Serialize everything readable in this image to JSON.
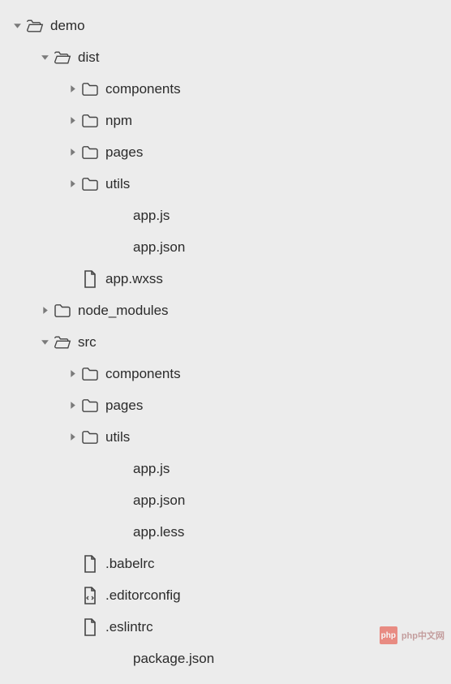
{
  "tree": [
    {
      "depth": 0,
      "arrow": "down",
      "icon": "folder-open",
      "label": "demo"
    },
    {
      "depth": 1,
      "arrow": "down",
      "icon": "folder-open",
      "label": "dist"
    },
    {
      "depth": 2,
      "arrow": "right",
      "icon": "folder",
      "label": "components"
    },
    {
      "depth": 2,
      "arrow": "right",
      "icon": "folder",
      "label": "npm"
    },
    {
      "depth": 2,
      "arrow": "right",
      "icon": "folder",
      "label": "pages"
    },
    {
      "depth": 2,
      "arrow": "right",
      "icon": "folder",
      "label": "utils"
    },
    {
      "depth": 3,
      "arrow": null,
      "icon": null,
      "label": "app.js"
    },
    {
      "depth": 3,
      "arrow": null,
      "icon": null,
      "label": "app.json"
    },
    {
      "depth": 2,
      "arrow": null,
      "icon": "file",
      "label": "app.wxss"
    },
    {
      "depth": 1,
      "arrow": "right",
      "icon": "folder",
      "label": "node_modules"
    },
    {
      "depth": 1,
      "arrow": "down",
      "icon": "folder-open",
      "label": "src"
    },
    {
      "depth": 2,
      "arrow": "right",
      "icon": "folder",
      "label": "components"
    },
    {
      "depth": 2,
      "arrow": "right",
      "icon": "folder",
      "label": "pages"
    },
    {
      "depth": 2,
      "arrow": "right",
      "icon": "folder",
      "label": "utils"
    },
    {
      "depth": 3,
      "arrow": null,
      "icon": null,
      "label": "app.js"
    },
    {
      "depth": 3,
      "arrow": null,
      "icon": null,
      "label": "app.json"
    },
    {
      "depth": 3,
      "arrow": null,
      "icon": null,
      "label": "app.less"
    },
    {
      "depth": 2,
      "arrow": null,
      "icon": "file",
      "label": ".babelrc"
    },
    {
      "depth": 2,
      "arrow": null,
      "icon": "file-code",
      "label": ".editorconfig"
    },
    {
      "depth": 2,
      "arrow": null,
      "icon": "file",
      "label": ".eslintrc"
    },
    {
      "depth": 3,
      "arrow": null,
      "icon": null,
      "label": "package.json"
    }
  ],
  "layout": {
    "indent_unit": 34
  },
  "watermark": {
    "badge": "php",
    "text": "php中文网"
  }
}
